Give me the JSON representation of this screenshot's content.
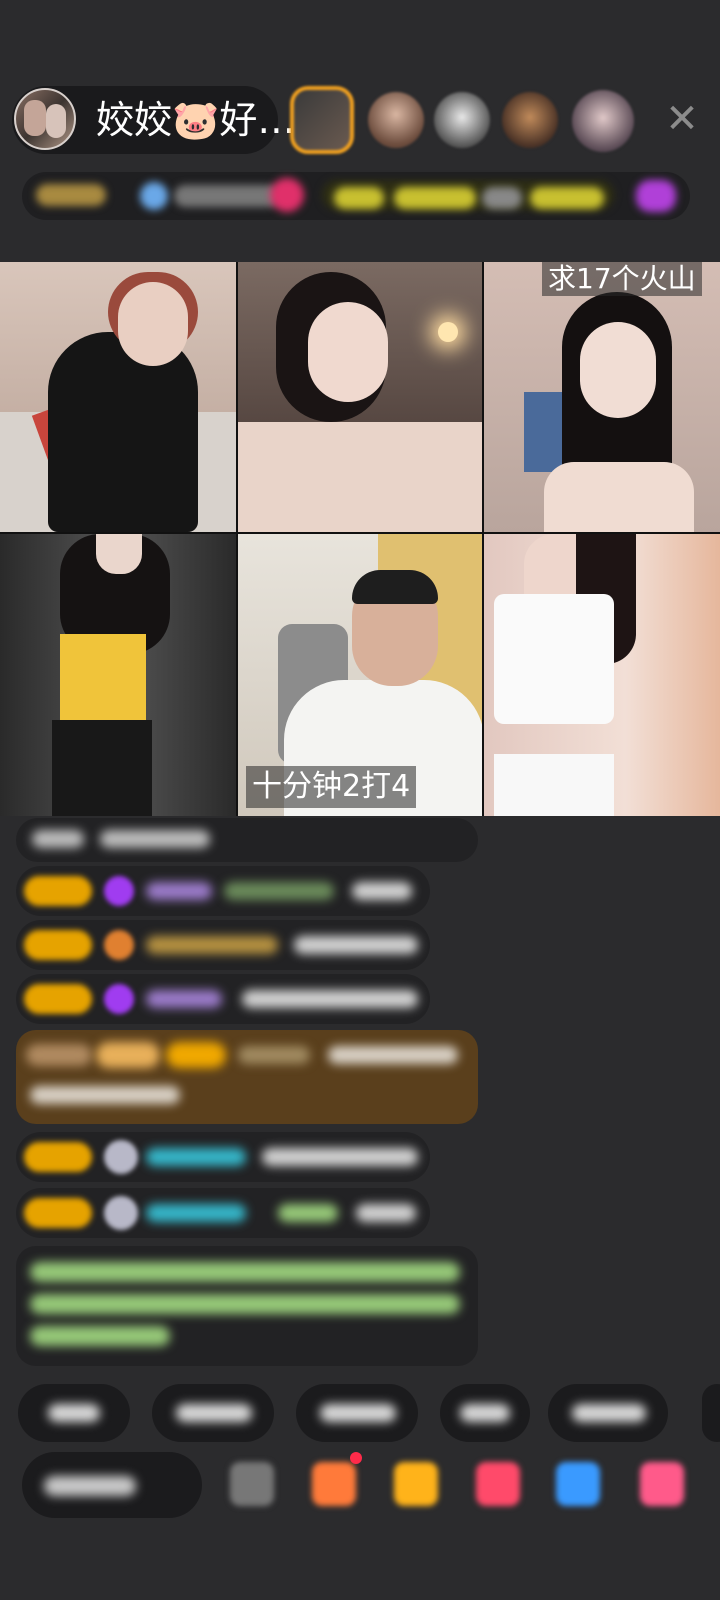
{
  "header": {
    "host_name": "姣姣🐷好…",
    "close_icon": "close-icon",
    "viewer_avatars": [
      {
        "name": "viewer-avatar-1",
        "ring": "#f0a020"
      },
      {
        "name": "viewer-avatar-2",
        "ring": ""
      },
      {
        "name": "viewer-avatar-3",
        "ring": ""
      },
      {
        "name": "viewer-avatar-4",
        "ring": ""
      },
      {
        "name": "viewer-avatar-5",
        "ring": ""
      }
    ]
  },
  "video_grid": {
    "captions": {
      "top_right": "求17个火山",
      "bottom_center": "十分钟2打4"
    }
  },
  "colors": {
    "background": "#2b2b2d",
    "badge_gold": "#e6a300",
    "gem_purple": "#a03cf0",
    "username_cyan": "#35b5c8",
    "highlight_brown": "#5a3f1c",
    "notice_green": "#96c878"
  },
  "icons": [
    "close-icon",
    "gift-icon",
    "fan-club-icon",
    "shop-icon",
    "more-icon",
    "message-icon"
  ]
}
